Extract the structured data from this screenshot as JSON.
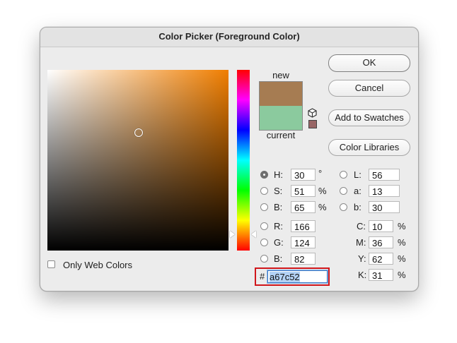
{
  "window": {
    "title": "Color Picker (Foreground Color)"
  },
  "preview": {
    "new_label": "new",
    "current_label": "current",
    "new_color": "#a67c52",
    "current_color": "#8bca9e"
  },
  "buttons": {
    "ok": "OK",
    "cancel": "Cancel",
    "add_to_swatches": "Add to Swatches",
    "color_libraries": "Color Libraries"
  },
  "hsb": {
    "h_label": "H:",
    "h_value": "30",
    "h_unit": "°",
    "s_label": "S:",
    "s_value": "51",
    "s_unit": "%",
    "b_label": "B:",
    "b_value": "65",
    "b_unit": "%"
  },
  "lab": {
    "l_label": "L:",
    "l_value": "56",
    "a_label": "a:",
    "a_value": "13",
    "b_label": "b:",
    "b_value": "30"
  },
  "rgb": {
    "r_label": "R:",
    "r_value": "166",
    "g_label": "G:",
    "g_value": "124",
    "b_label": "B:",
    "b_value": "82"
  },
  "cmyk": {
    "c_label": "C:",
    "c_value": "10",
    "c_unit": "%",
    "m_label": "M:",
    "m_value": "36",
    "m_unit": "%",
    "y_label": "Y:",
    "y_value": "62",
    "y_unit": "%",
    "k_label": "K:",
    "k_value": "31",
    "k_unit": "%"
  },
  "hex": {
    "prefix": "#",
    "value": "a67c52"
  },
  "options": {
    "only_web_colors_label": "Only Web Colors",
    "only_web_colors_checked": false
  },
  "field_hue_color": "#f07e00",
  "highlight_color": "#d0161b"
}
